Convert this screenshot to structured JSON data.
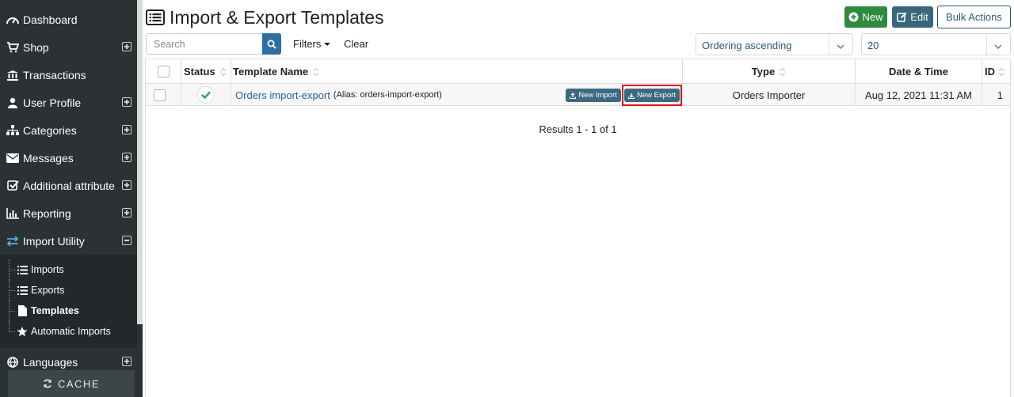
{
  "sidebar": {
    "items": [
      {
        "label": "Dashboard",
        "icon": "dashboard-icon",
        "expandable": false
      },
      {
        "label": "Shop",
        "icon": "cart-icon",
        "expandable": true
      },
      {
        "label": "Transactions",
        "icon": "bank-icon",
        "expandable": false
      },
      {
        "label": "User Profile",
        "icon": "user-icon",
        "expandable": true
      },
      {
        "label": "Categories",
        "icon": "sitemap-icon",
        "expandable": true
      },
      {
        "label": "Messages",
        "icon": "envelope-icon",
        "expandable": true
      },
      {
        "label": "Additional attribute",
        "icon": "check-square-icon",
        "expandable": true
      },
      {
        "label": "Reporting",
        "icon": "bar-chart-icon",
        "expandable": true
      },
      {
        "label": "Import Utility",
        "icon": "exchange-icon",
        "expandable": true,
        "expanded": true
      },
      {
        "label": "Languages",
        "icon": "globe-icon",
        "expandable": true
      }
    ],
    "submenu": [
      {
        "label": "Imports",
        "icon": "list-icon"
      },
      {
        "label": "Exports",
        "icon": "list-icon"
      },
      {
        "label": "Templates",
        "icon": "file-icon",
        "current": true
      },
      {
        "label": "Automatic Imports",
        "icon": "star-icon"
      }
    ],
    "cache_label": "CACHE",
    "accent_color": "#4db3e6"
  },
  "header": {
    "title": "Import & Export Templates",
    "buttons": {
      "new": "New",
      "edit": "Edit",
      "bulk": "Bulk Actions"
    }
  },
  "toolbar": {
    "search_placeholder": "Search",
    "filters_label": "Filters",
    "clear_label": "Clear",
    "ordering_value": "Ordering ascending",
    "limit_value": "20"
  },
  "table": {
    "columns": [
      "Status",
      "Template Name",
      "Type",
      "Date & Time",
      "ID"
    ],
    "rows": [
      {
        "status": "published",
        "name": "Orders import-export",
        "alias": "(Alias: orders-import-export)",
        "new_import_label": "New Import",
        "new_export_label": "New Export",
        "type": "Orders Importer",
        "datetime": "Aug 12, 2021 11:31 AM",
        "id": "1"
      }
    ],
    "results_text": "Results 1 - 1 of 1"
  },
  "colors": {
    "sidebar_bg": "#2c3134",
    "new_button": "#2f8a3e",
    "edit_button": "#39667d",
    "link": "#2a5da6",
    "highlight": "#e0141e"
  }
}
